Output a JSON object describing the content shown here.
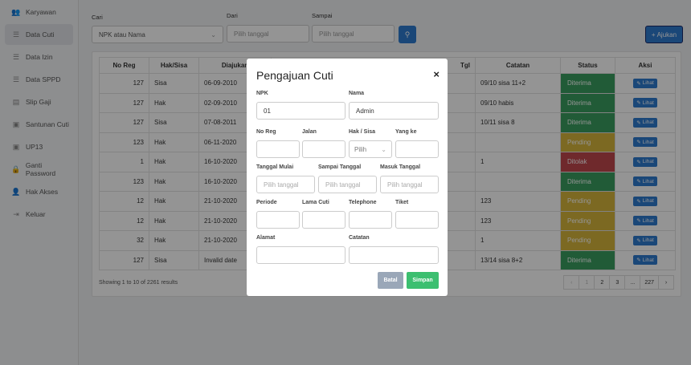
{
  "colors": {
    "primary": "#2e7bcf",
    "success": "#3a9e5f",
    "warning": "#d6b53c",
    "danger": "#c0474d",
    "save": "#3cbf70",
    "cancel": "#9aa7b8"
  },
  "sidebar": {
    "items": [
      {
        "label": "Karyawan",
        "icon": "users-icon",
        "active": false
      },
      {
        "label": "Data Cuti",
        "icon": "list-icon",
        "active": true
      },
      {
        "label": "Data Izin",
        "icon": "list-icon",
        "active": false
      },
      {
        "label": "Data SPPD",
        "icon": "list-icon",
        "active": false
      },
      {
        "label": "Slip Gaji",
        "icon": "slip-icon",
        "active": false
      },
      {
        "label": "Santunan Cuti",
        "icon": "money-icon",
        "active": false
      },
      {
        "label": "UP13",
        "icon": "money-icon",
        "active": false
      },
      {
        "label": "Ganti Password",
        "icon": "lock-icon",
        "active": false
      },
      {
        "label": "Hak Akses",
        "icon": "user-icon",
        "active": false
      },
      {
        "label": "Keluar",
        "icon": "logout-icon",
        "active": false
      }
    ]
  },
  "filters": {
    "cari_label": "Cari",
    "cari_value": "NPK atau Nama",
    "dari_label": "Dari",
    "dari_placeholder": "Pilih tanggal",
    "sampai_label": "Sampai",
    "sampai_placeholder": "Pilih tanggal",
    "ajukan_label": "Ajukan"
  },
  "table": {
    "headers": [
      "No Reg",
      "Hak/Sisa",
      "Diajukan",
      "Tgl",
      "Catatan",
      "Status",
      "Aksi"
    ],
    "rows": [
      {
        "noreg": "127",
        "hak": "Sisa",
        "diajukan": "06-09-2010",
        "catatan": "09/10 sisa 11+2",
        "status": "Diterima",
        "status_kind": "success"
      },
      {
        "noreg": "127",
        "hak": "Hak",
        "diajukan": "02-09-2010",
        "catatan": "09/10 habis",
        "status": "Diterima",
        "status_kind": "success"
      },
      {
        "noreg": "127",
        "hak": "Sisa",
        "diajukan": "07-08-2011",
        "catatan": "10/11 sisa 8",
        "status": "Diterima",
        "status_kind": "success"
      },
      {
        "noreg": "123",
        "hak": "Hak",
        "diajukan": "06-11-2020",
        "catatan": "",
        "status": "Pending",
        "status_kind": "warning"
      },
      {
        "noreg": "1",
        "hak": "Hak",
        "diajukan": "16-10-2020",
        "catatan": "1",
        "status": "Ditolak",
        "status_kind": "danger"
      },
      {
        "noreg": "123",
        "hak": "Hak",
        "diajukan": "16-10-2020",
        "catatan": "",
        "status": "Diterima",
        "status_kind": "success"
      },
      {
        "noreg": "12",
        "hak": "Hak",
        "diajukan": "21-10-2020",
        "catatan": "123",
        "status": "Pending",
        "status_kind": "warning"
      },
      {
        "noreg": "12",
        "hak": "Hak",
        "diajukan": "21-10-2020",
        "catatan": "123",
        "status": "Pending",
        "status_kind": "warning"
      },
      {
        "noreg": "32",
        "hak": "Hak",
        "diajukan": "21-10-2020",
        "catatan": "1",
        "status": "Pending",
        "status_kind": "warning"
      },
      {
        "noreg": "127",
        "hak": "Sisa",
        "diajukan": "Invalid date",
        "catatan": "13/14 sisa 8+2",
        "status": "Diterima",
        "status_kind": "success"
      }
    ],
    "action_label": "Lihat",
    "summary": "Showing 1 to 10 of 2261 results",
    "pagination": [
      "‹",
      "1",
      "2",
      "3",
      "...",
      "227",
      "›"
    ]
  },
  "modal": {
    "title": "Pengajuan Cuti",
    "npk_label": "NPK",
    "npk_value": "01",
    "nama_label": "Nama",
    "nama_value": "Admin",
    "noreg_label": "No Reg",
    "jalan_label": "Jalan",
    "haksisa_label": "Hak / Sisa",
    "haksisa_value": "Pilih",
    "yangke_label": "Yang ke",
    "tglmulai_label": "Tanggal Mulai",
    "tglmulai_placeholder": "Pilih tanggal",
    "sampaitgl_label": "Sampai Tanggal",
    "sampaitgl_placeholder": "Pilih tanggal",
    "masuktgl_label": "Masuk Tanggal",
    "masuktgl_placeholder": "Pilih tanggal",
    "periode_label": "Periode",
    "lamacuti_label": "Lama Cuti",
    "telephone_label": "Telephone",
    "tiket_label": "Tiket",
    "alamat_label": "Alamat",
    "catatan_label": "Catatan",
    "batal_label": "Batal",
    "simpan_label": "Simpan"
  }
}
